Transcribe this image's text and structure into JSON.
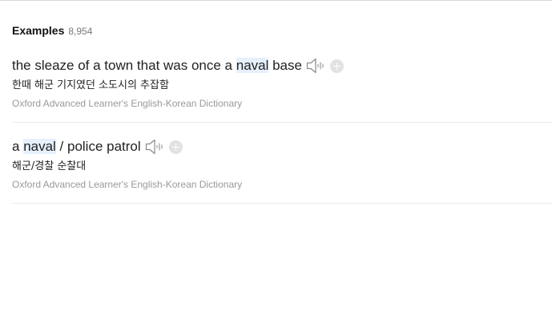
{
  "examples": {
    "title": "Examples",
    "count": "8,954",
    "items": [
      {
        "before": "the sleaze of a town that was once a ",
        "highlight": "naval",
        "after": " base",
        "translation": "한때 해군 기지였던 소도시의 추잡함",
        "source": "Oxford Advanced Learner's English-Korean Dictionary"
      },
      {
        "before": "a ",
        "highlight": "naval",
        "after": " / police patrol",
        "translation": "해군/경찰 순찰대",
        "source": "Oxford Advanced Learner's English-Korean Dictionary"
      }
    ]
  },
  "icons": {
    "speaker": "speaker-icon",
    "add": "plus-circle-icon"
  }
}
